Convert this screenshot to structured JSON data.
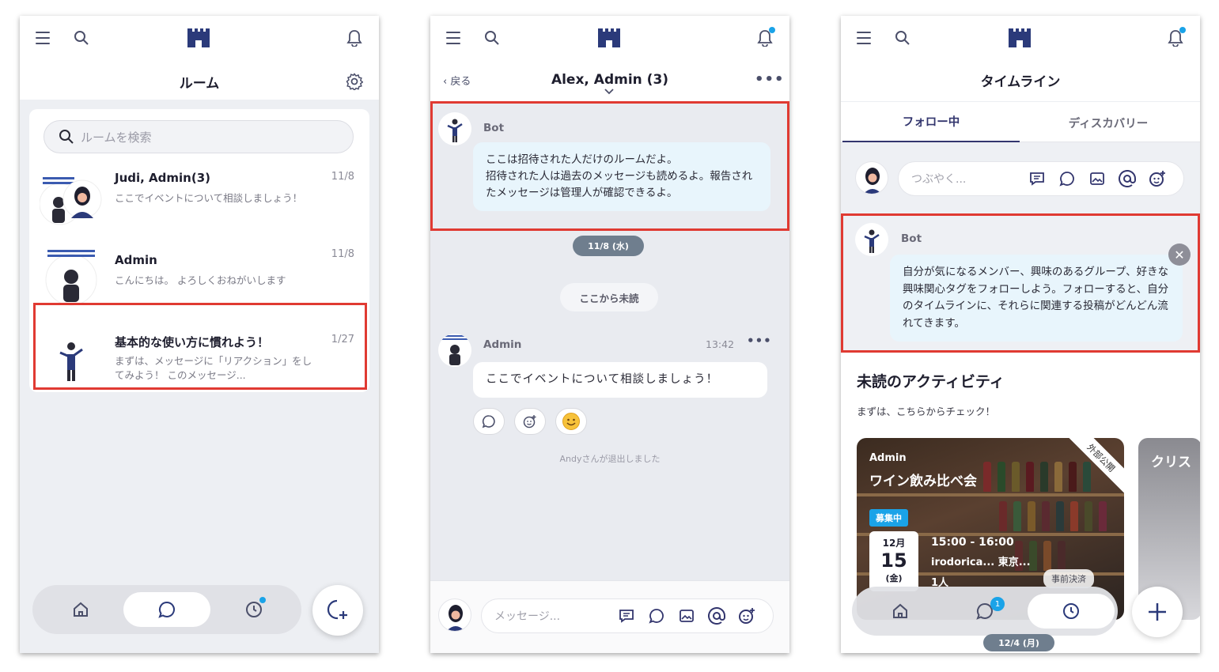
{
  "colors": {
    "accent": "#33366e",
    "highlight": "#e03a32",
    "notification": "#1aa3e8",
    "bubble": "#e8f5fc"
  },
  "icons": {
    "menu": "hamburger-icon",
    "search": "search-icon",
    "logo": "castle-logo",
    "bell": "bell-icon",
    "settings": "gear-icon"
  },
  "screen1": {
    "title": "ルーム",
    "search_placeholder": "ルームを検索",
    "rooms": [
      {
        "name": "Judi, Admin(3)",
        "date": "11/8",
        "preview": "ここでイベントについて相談しましょう！"
      },
      {
        "name": "Admin",
        "date": "11/8",
        "preview": "こんにちは。 よろしくおねがいします"
      },
      {
        "name": "基本的な使い方に慣れよう！",
        "date": "1/27",
        "preview": "まずは、メッセージに「リアクション」をしてみよう！ このメッセージ..."
      }
    ]
  },
  "screen2": {
    "back": "戻る",
    "title": "Alex, Admin (3)",
    "bot_name": "Bot",
    "bot_message_line1": "ここは招待された人だけのルームだよ。",
    "bot_message_line2": "招待された人は過去のメッセージも読めるよ。報告されたメッセージは管理人が確認できるよ。",
    "date_pill": "11/8 (水)",
    "unread_pill": "ここから未読",
    "admin_name": "Admin",
    "admin_time": "13:42",
    "admin_message": "ここでイベントについて相談しましょう！",
    "system_message": "Andyさんが退出しました",
    "input_placeholder": "メッセージ..."
  },
  "screen3": {
    "title": "タイムライン",
    "tabs": [
      "フォロー中",
      "ディスカバリー"
    ],
    "post_placeholder": "つぶやく...",
    "bot_name": "Bot",
    "bot_message": "自分が気になるメンバー、興味のあるグループ、好きな興味関心タグをフォローしよう。フォローすると、自分のタイムラインに、それらに関連する投稿がどんどん流れてきます。",
    "section_title": "未読のアクティビティ",
    "section_sub": "まずは、こちらからチェック！",
    "event": {
      "author": "Admin",
      "title": "ワイン飲み比べ会",
      "ribbon": "外部公開",
      "status": "募集中",
      "month": "12月",
      "day": "15",
      "weekday": "(金)",
      "time": "15:00 - 16:00",
      "place": "irodorica...  東京...",
      "count": "1人",
      "payment": "事前決済"
    },
    "event2_title": "クリス",
    "chat_badge": "1",
    "bottom_date": "12/4 (月)"
  }
}
